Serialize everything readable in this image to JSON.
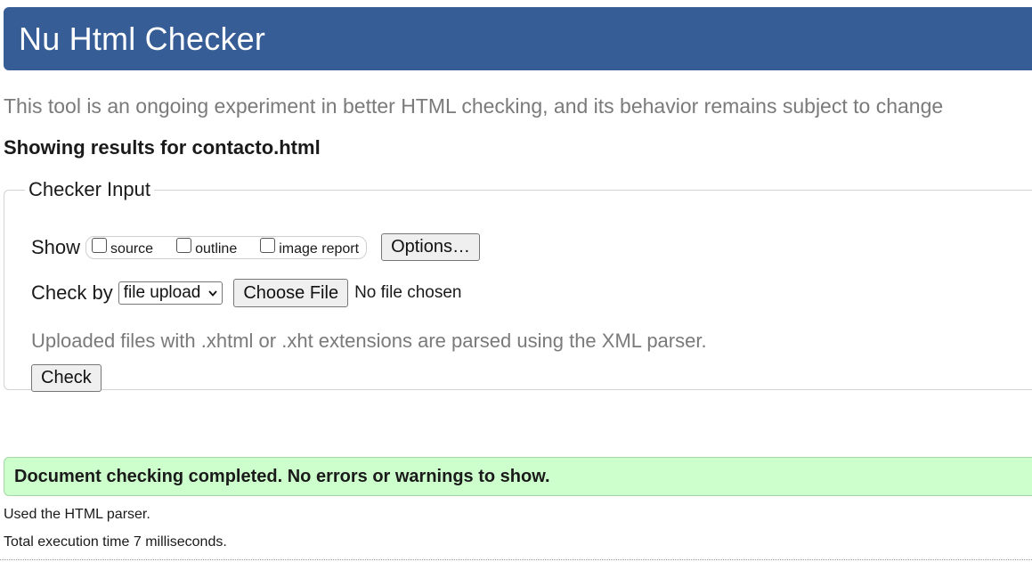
{
  "header": {
    "title": "Nu Html Checker",
    "color": "#365d95"
  },
  "intro": "This tool is an ongoing experiment in better HTML checking, and its behavior remains subject to change",
  "results_for": "Showing results for contacto.html",
  "checker_input": {
    "legend": "Checker Input",
    "show_label": "Show",
    "show_options": [
      {
        "label": "source",
        "checked": false
      },
      {
        "label": "outline",
        "checked": false
      },
      {
        "label": "image report",
        "checked": false
      }
    ],
    "options_button": "Options…",
    "check_by_label": "Check by",
    "check_by_selected": "file upload",
    "choose_file_button": "Choose File",
    "no_file_text": "No file chosen",
    "parser_note": "Uploaded files with .xhtml or .xht extensions are parsed using the XML parser.",
    "check_button": "Check"
  },
  "result": {
    "message": "Document checking completed. No errors or warnings to show.",
    "color": "#ccffcc"
  },
  "stats": {
    "parser": "Used the HTML parser.",
    "time": "Total execution time 7 milliseconds."
  }
}
